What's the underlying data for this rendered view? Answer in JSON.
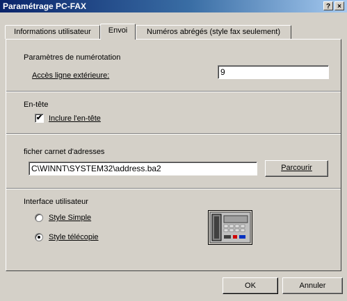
{
  "window": {
    "title": "Paramétrage PC-FAX",
    "help_button": "?",
    "close_button": "×"
  },
  "tabs": [
    {
      "label": "Informations utilisateur"
    },
    {
      "label": "Envoi"
    },
    {
      "label": "Numéros abrégés (style fax seulement)"
    }
  ],
  "dialing": {
    "group_label": "Paramètres de numérotation",
    "outside_line_label": "Accès ligne extérieure:",
    "outside_line_value": "9"
  },
  "header": {
    "group_label": "En-tête",
    "include_label": "Inclure l'en-tête",
    "include_checked": true
  },
  "address_book": {
    "group_label": "ficher carnet d'adresses",
    "path_value": "C\\WINNT\\SYSTEM32\\address.ba2",
    "browse_label": "Parcourir"
  },
  "ui": {
    "group_label": "Interface utilisateur",
    "options": [
      {
        "label": "Style Simple",
        "selected": false
      },
      {
        "label": "Style télécopie",
        "selected": true
      }
    ]
  },
  "footer": {
    "ok_label": "OK",
    "cancel_label": "Annuler"
  }
}
